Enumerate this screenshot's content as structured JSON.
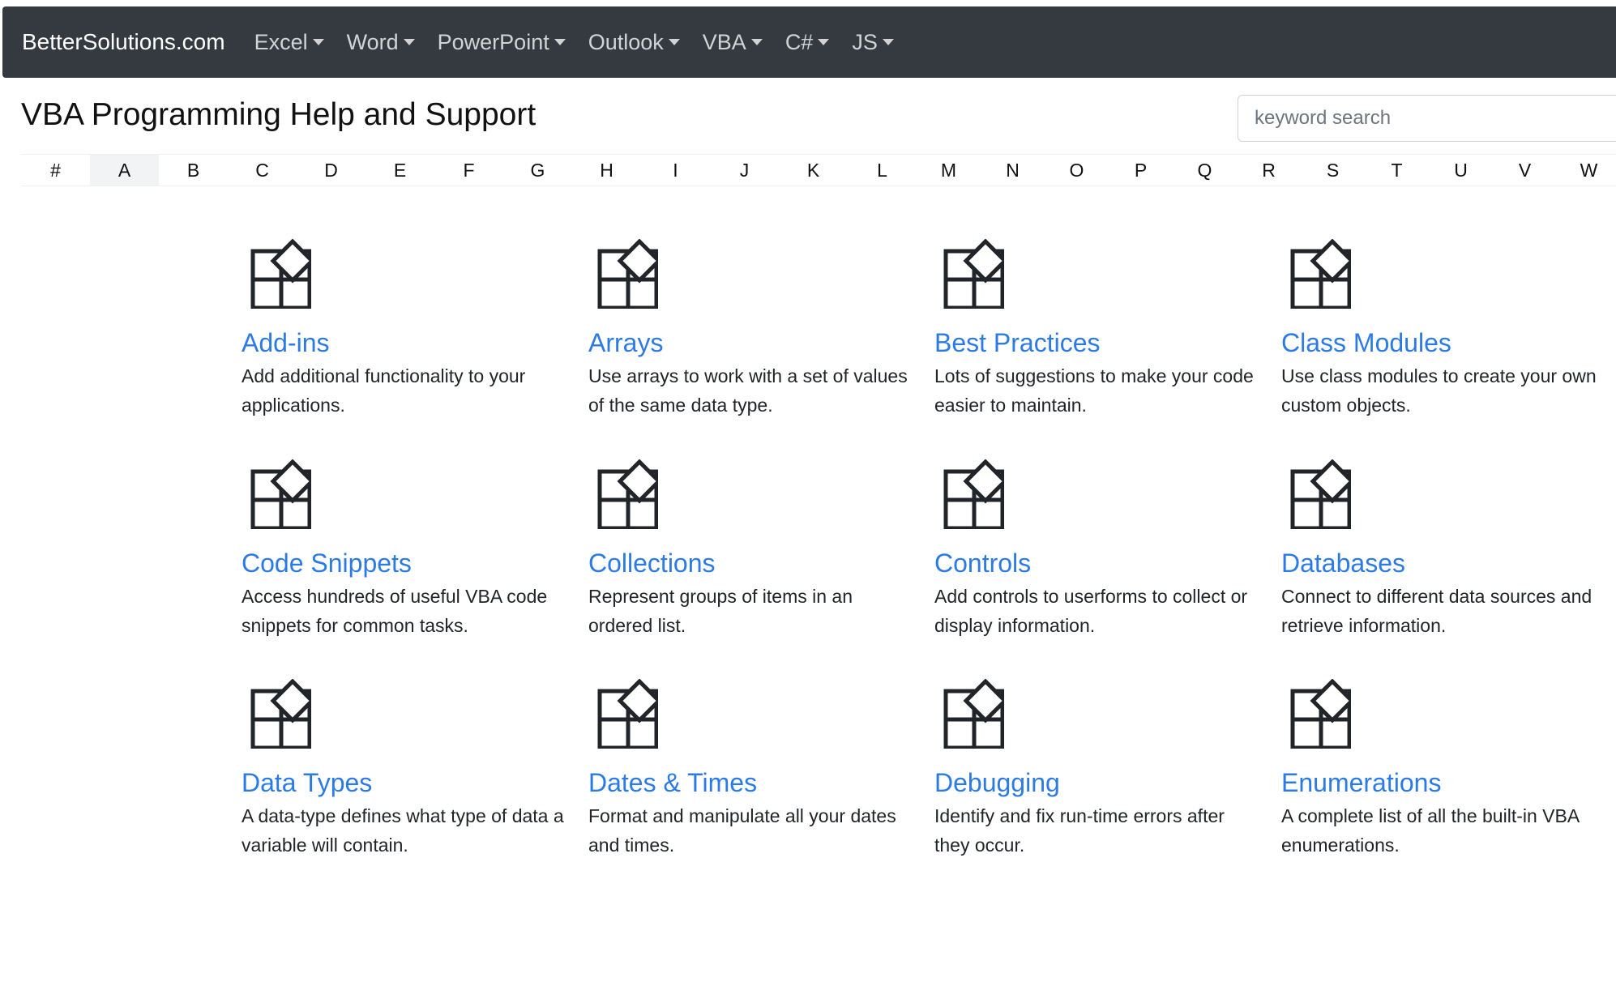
{
  "navbar": {
    "brand": "BetterSolutions.com",
    "items": [
      {
        "label": "Excel"
      },
      {
        "label": "Word"
      },
      {
        "label": "PowerPoint"
      },
      {
        "label": "Outlook"
      },
      {
        "label": "VBA"
      },
      {
        "label": "C#"
      },
      {
        "label": "JS"
      }
    ],
    "background_color": "#343a40"
  },
  "page": {
    "title": "VBA Programming Help and Support",
    "search_placeholder": "keyword search"
  },
  "alphabet": {
    "letters": [
      "#",
      "A",
      "B",
      "C",
      "D",
      "E",
      "F",
      "G",
      "H",
      "I",
      "J",
      "K",
      "L",
      "M",
      "N",
      "O",
      "P",
      "Q",
      "R",
      "S",
      "T",
      "U",
      "V",
      "W"
    ],
    "active": "A"
  },
  "topics": [
    {
      "title": "Add-ins",
      "description": "Add additional functionality to your applications.",
      "icon": "app-tiles-icon"
    },
    {
      "title": "Arrays",
      "description": "Use arrays to work with a set of values of the same data type.",
      "icon": "app-tiles-icon"
    },
    {
      "title": "Best Practices",
      "description": "Lots of suggestions to make your code easier to maintain.",
      "icon": "app-tiles-icon"
    },
    {
      "title": "Class Modules",
      "description": "Use class modules to create your own custom objects.",
      "icon": "app-tiles-icon"
    },
    {
      "title": "Code Snippets",
      "description": "Access hundreds of useful VBA code snippets for common tasks.",
      "icon": "app-tiles-icon"
    },
    {
      "title": "Collections",
      "description": "Represent groups of items in an ordered list.",
      "icon": "app-tiles-icon"
    },
    {
      "title": "Controls",
      "description": "Add controls to userforms to collect or display information.",
      "icon": "app-tiles-icon"
    },
    {
      "title": "Databases",
      "description": "Connect to different data sources and retrieve information.",
      "icon": "app-tiles-icon"
    },
    {
      "title": "Data Types",
      "description": "A data-type defines what type of data a variable will contain.",
      "icon": "app-tiles-icon"
    },
    {
      "title": "Dates & Times",
      "description": "Format and manipulate all your dates and times.",
      "icon": "app-tiles-icon"
    },
    {
      "title": "Debugging",
      "description": "Identify and fix run-time errors after they occur.",
      "icon": "app-tiles-icon"
    },
    {
      "title": "Enumerations",
      "description": "A complete list of all the built-in VBA enumerations.",
      "icon": "app-tiles-icon"
    }
  ],
  "colors": {
    "link": "#2c7be5",
    "text": "#212529"
  }
}
